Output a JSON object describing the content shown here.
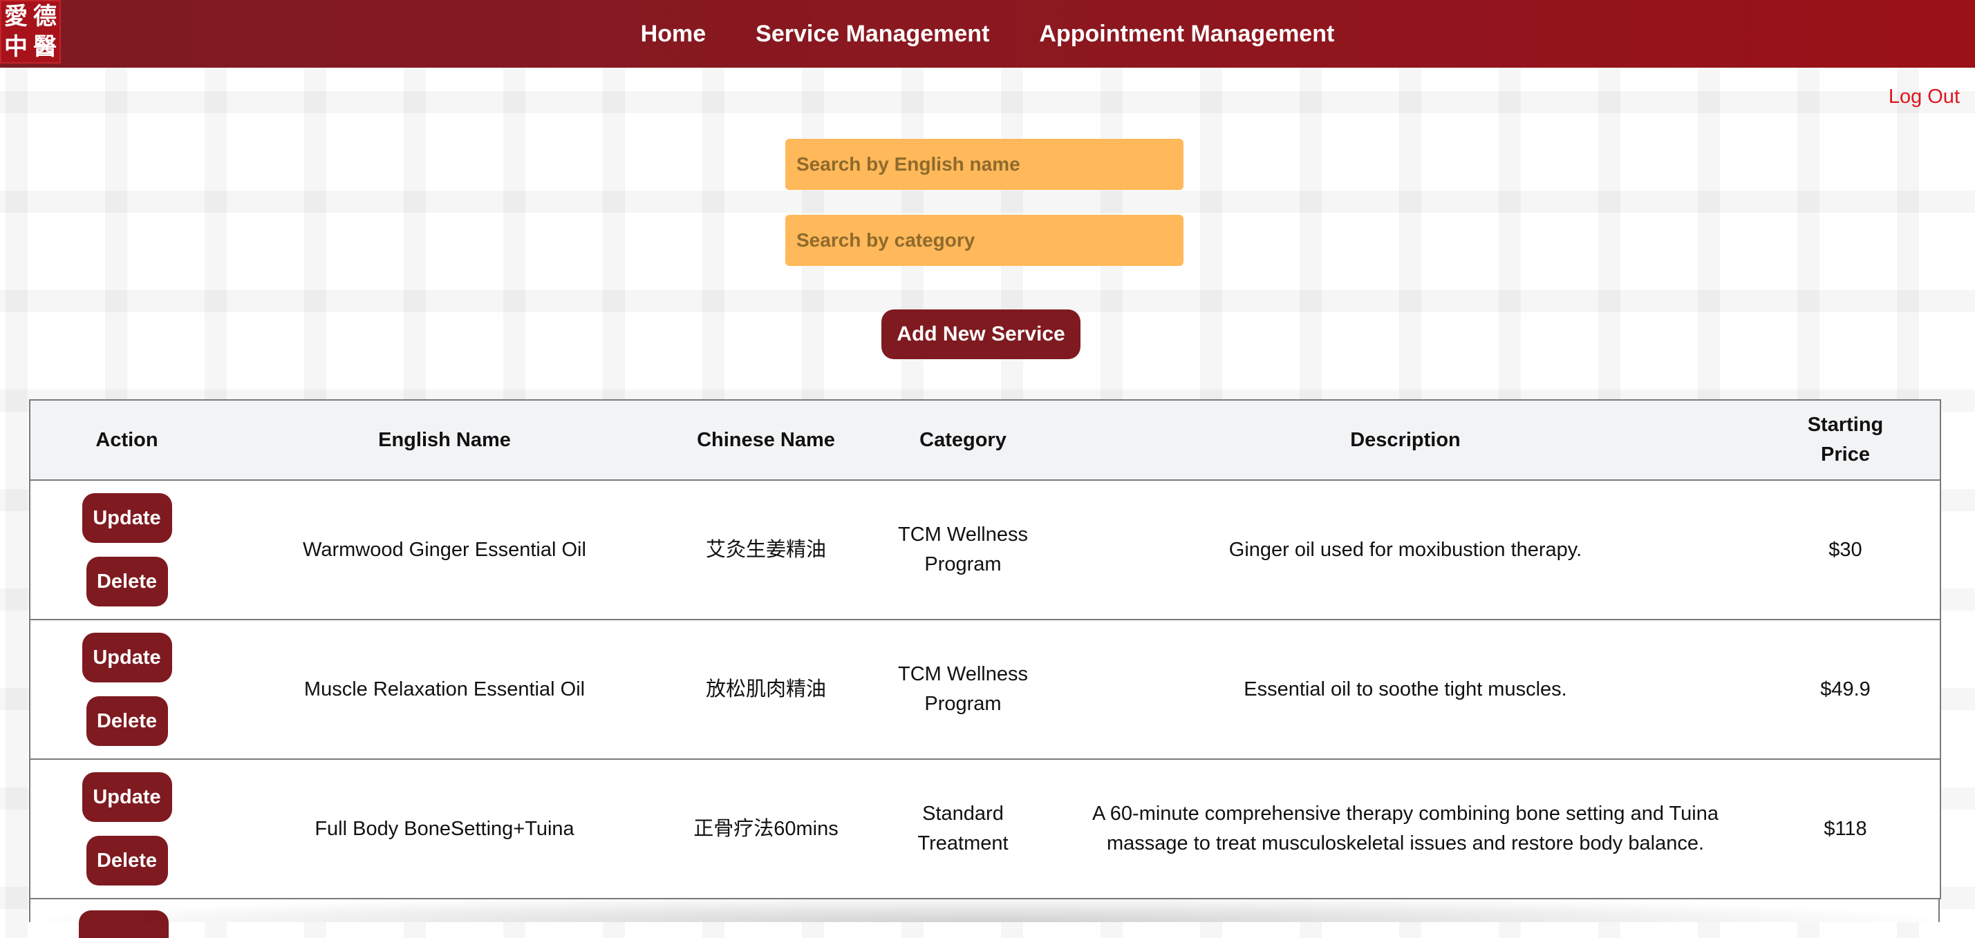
{
  "logo": {
    "chars": [
      "愛",
      "德",
      "中",
      "醫"
    ]
  },
  "nav": {
    "home": "Home",
    "service": "Service Management",
    "appointment": "Appointment Management"
  },
  "logout": "Log Out",
  "search": {
    "name_placeholder": "Search by English name",
    "category_placeholder": "Search by category"
  },
  "add_button": "Add New Service",
  "table": {
    "headers": [
      "Action",
      "English Name",
      "Chinese Name",
      "Category",
      "Description",
      "Starting Price"
    ],
    "update_label": "Update",
    "delete_label": "Delete",
    "rows": [
      {
        "english": "Warmwood Ginger Essential Oil",
        "chinese": "艾灸生姜精油",
        "category": "TCM Wellness Program",
        "description": "Ginger oil used for moxibustion therapy.",
        "price": "$30"
      },
      {
        "english": "Muscle Relaxation Essential Oil",
        "chinese": "放松肌肉精油",
        "category": "TCM Wellness Program",
        "description": "Essential oil to soothe tight muscles.",
        "price": "$49.9"
      },
      {
        "english": "Full Body BoneSetting+Tuina",
        "chinese": "正骨疗法60mins",
        "category": "Standard Treatment",
        "description": "A 60-minute comprehensive therapy combining bone setting and Tuina massage to treat musculoskeletal issues and restore body balance.",
        "price": "$118"
      }
    ]
  },
  "colors": {
    "nav_bg": "#8b1820",
    "button": "#7f1a20",
    "search_bg": "#ffb95a",
    "logout": "#e0151d"
  }
}
